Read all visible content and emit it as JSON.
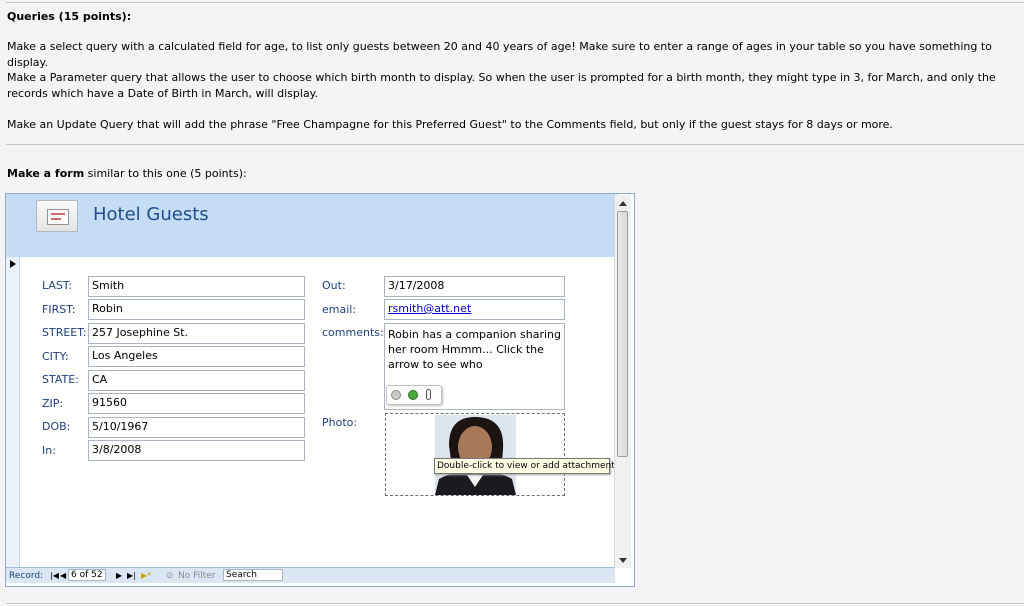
{
  "queries": {
    "heading": "Queries (15 points):",
    "items": [
      "Make a select query with a calculated field for age,  to list only guests between 20 and 40 years of age! Make sure to enter a range of ages in your table so you have something to display.",
      "Make a Parameter query that allows the user to choose which birth month to display. So when the user is  prompted for a birth month, they might type in 3, for March, and only the records which have a Date of Birth in March, will display.",
      "Make an Update Query that will add the phrase \"Free Champagne for this Preferred Guest\" to the Comments field, but only if the guest stays for 8 days or more."
    ]
  },
  "form_section": {
    "intro_bold": "Make a form",
    "intro_rest": " similar to this one (5 points):"
  },
  "form": {
    "title": "Hotel Guests",
    "fields_left": [
      {
        "label": "LAST:",
        "value": "Smith"
      },
      {
        "label": "FIRST:",
        "value": "Robin"
      },
      {
        "label": "STREET:",
        "value": "257 Josephine St."
      },
      {
        "label": "CITY:",
        "value": "Los Angeles"
      },
      {
        "label": "STATE:",
        "value": "CA"
      },
      {
        "label": "ZIP:",
        "value": "91560"
      },
      {
        "label": "DOB:",
        "value": "5/10/1967"
      },
      {
        "label": "In:",
        "value": "3/8/2008"
      }
    ],
    "out": {
      "label": "Out:",
      "value": "3/17/2008"
    },
    "email": {
      "label": "email:",
      "value": "rsmith@att.net"
    },
    "comments": {
      "label": "comments:",
      "value": "Robin has a companion sharing her room Hmmm... Click the arrow to see who"
    },
    "photo": {
      "label": "Photo:",
      "tooltip": "Double-click to view or add attachments."
    },
    "colors": {
      "header": "#c4dcf4",
      "title": "#1f4e8c",
      "label": "#1f3f7a"
    }
  },
  "navbar": {
    "record_label": "Record:",
    "first": "|◀",
    "prev": "◀",
    "position": "6 of 52",
    "next": "▶",
    "last": "▶|",
    "new": "▶*",
    "filter": "No Filter",
    "search": "Search"
  }
}
